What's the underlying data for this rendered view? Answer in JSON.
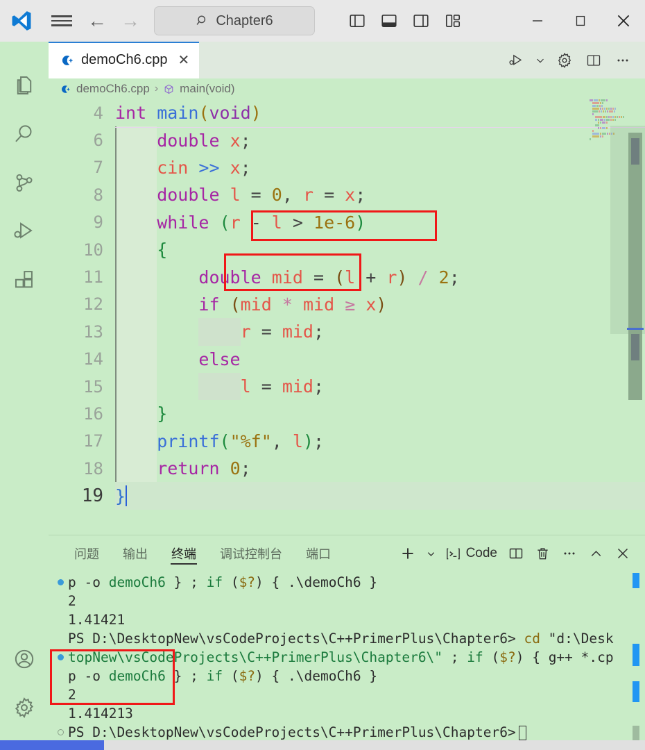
{
  "titlebar": {
    "logo_icon": "vscode-logo-icon",
    "menu_icon": "hamburger-menu-icon",
    "back_icon": "arrow-back-icon",
    "forward_icon": "arrow-forward-icon",
    "command_center": {
      "icon": "search-icon",
      "text": "Chapter6"
    },
    "layout_buttons": [
      {
        "name": "toggle-primary-sidebar",
        "icon": "panel-left-icon"
      },
      {
        "name": "toggle-panel",
        "icon": "panel-bottom-icon"
      },
      {
        "name": "toggle-secondary-sidebar",
        "icon": "panel-right-icon"
      },
      {
        "name": "customize-layout",
        "icon": "layout-grid-icon"
      }
    ],
    "window_controls": [
      {
        "name": "minimize-button",
        "glyph": "─"
      },
      {
        "name": "maximize-button",
        "glyph": "☐"
      },
      {
        "name": "close-button",
        "glyph": "✕"
      }
    ]
  },
  "activitybar": {
    "items": [
      {
        "name": "sidebar-item-explorer",
        "icon": "files-icon"
      },
      {
        "name": "sidebar-item-search",
        "icon": "search-icon"
      },
      {
        "name": "sidebar-item-source-control",
        "icon": "source-control-icon"
      },
      {
        "name": "sidebar-item-run-debug",
        "icon": "run-and-debug-icon"
      },
      {
        "name": "sidebar-item-extensions",
        "icon": "extensions-icon"
      }
    ],
    "bottom_items": [
      {
        "name": "sidebar-item-account",
        "icon": "account-icon"
      },
      {
        "name": "sidebar-item-settings",
        "icon": "gear-icon"
      }
    ]
  },
  "tabs": {
    "active": {
      "label": "demoCh6.cpp",
      "icon": "cpp-file-icon",
      "close_glyph": "✕"
    },
    "editor_actions": [
      {
        "name": "run-or-debug-button",
        "icon": "run-debug-icon"
      },
      {
        "name": "run-debug-dropdown",
        "icon": "chevron-down-icon"
      },
      {
        "name": "settings-gear-button",
        "icon": "gear-icon"
      },
      {
        "name": "split-editor-button",
        "icon": "split-editor-icon"
      },
      {
        "name": "more-actions-button",
        "icon": "ellipsis-icon"
      }
    ]
  },
  "breadcrumb": {
    "file_icon": "cpp-file-icon",
    "file": "demoCh6.cpp",
    "separator": "›",
    "symbol_icon": "symbol-method-icon",
    "symbol": "main(void)"
  },
  "editor": {
    "language": "cpp",
    "lines": [
      {
        "number": "4",
        "tokens": [
          {
            "t": "int",
            "c": "kw"
          },
          {
            "t": " ",
            "c": "punc"
          },
          {
            "t": "main",
            "c": "fn"
          },
          {
            "t": "(",
            "c": "pnt2"
          },
          {
            "t": "void",
            "c": "kw2"
          },
          {
            "t": ")",
            "c": "pnt2"
          }
        ]
      },
      {
        "number": "6",
        "tokens": [
          {
            "t": "double",
            "c": "kw"
          },
          {
            "t": " ",
            "c": "punc"
          },
          {
            "t": "x",
            "c": "var"
          },
          {
            "t": ";",
            "c": "punc"
          }
        ]
      },
      {
        "number": "7",
        "tokens": [
          {
            "t": "cin",
            "c": "var"
          },
          {
            "t": " ",
            "c": "punc"
          },
          {
            "t": ">>",
            "c": "fn"
          },
          {
            "t": " ",
            "c": "punc"
          },
          {
            "t": "x",
            "c": "var"
          },
          {
            "t": ";",
            "c": "punc"
          }
        ]
      },
      {
        "number": "8",
        "tokens": [
          {
            "t": "double",
            "c": "kw"
          },
          {
            "t": " ",
            "c": "punc"
          },
          {
            "t": "l",
            "c": "var"
          },
          {
            "t": " = ",
            "c": "punc"
          },
          {
            "t": "0",
            "c": "num"
          },
          {
            "t": ", ",
            "c": "punc"
          },
          {
            "t": "r",
            "c": "var"
          },
          {
            "t": " = ",
            "c": "punc"
          },
          {
            "t": "x",
            "c": "var"
          },
          {
            "t": ";",
            "c": "punc"
          }
        ]
      },
      {
        "number": "9",
        "tokens": [
          {
            "t": "while",
            "c": "kw"
          },
          {
            "t": " ",
            "c": "punc"
          },
          {
            "t": "(",
            "c": "pnt1"
          },
          {
            "t": "r",
            "c": "var"
          },
          {
            "t": " - ",
            "c": "punc"
          },
          {
            "t": "l",
            "c": "var"
          },
          {
            "t": " > ",
            "c": "punc"
          },
          {
            "t": "1e-6",
            "c": "num"
          },
          {
            "t": ")",
            "c": "pnt1"
          }
        ]
      },
      {
        "number": "10",
        "tokens": [
          {
            "t": "{",
            "c": "brace"
          }
        ]
      },
      {
        "number": "11",
        "tokens": [
          {
            "t": "double",
            "c": "kw"
          },
          {
            "t": " ",
            "c": "punc"
          },
          {
            "t": "mid",
            "c": "var"
          },
          {
            "t": " = ",
            "c": "punc"
          },
          {
            "t": "(",
            "c": "pnt3"
          },
          {
            "t": "l",
            "c": "var"
          },
          {
            "t": " + ",
            "c": "punc"
          },
          {
            "t": "r",
            "c": "var"
          },
          {
            "t": ")",
            "c": "pnt3"
          },
          {
            "t": " ",
            "c": "punc"
          },
          {
            "t": "/",
            "c": "op"
          },
          {
            "t": " ",
            "c": "punc"
          },
          {
            "t": "2",
            "c": "num"
          },
          {
            "t": ";",
            "c": "punc"
          }
        ]
      },
      {
        "number": "12",
        "tokens": [
          {
            "t": "if",
            "c": "kw"
          },
          {
            "t": " ",
            "c": "punc"
          },
          {
            "t": "(",
            "c": "pnt3"
          },
          {
            "t": "mid",
            "c": "var"
          },
          {
            "t": " ",
            "c": "punc"
          },
          {
            "t": "*",
            "c": "op"
          },
          {
            "t": " ",
            "c": "punc"
          },
          {
            "t": "mid",
            "c": "var"
          },
          {
            "t": " ",
            "c": "punc"
          },
          {
            "t": "≥",
            "c": "op"
          },
          {
            "t": " ",
            "c": "punc"
          },
          {
            "t": "x",
            "c": "var"
          },
          {
            "t": ")",
            "c": "pnt3"
          }
        ]
      },
      {
        "number": "13",
        "tokens": [
          {
            "t": "r",
            "c": "var"
          },
          {
            "t": " = ",
            "c": "punc"
          },
          {
            "t": "mid",
            "c": "var"
          },
          {
            "t": ";",
            "c": "punc"
          }
        ]
      },
      {
        "number": "14",
        "tokens": [
          {
            "t": "else",
            "c": "kw"
          }
        ]
      },
      {
        "number": "15",
        "tokens": [
          {
            "t": "l",
            "c": "var"
          },
          {
            "t": " = ",
            "c": "punc"
          },
          {
            "t": "mid",
            "c": "var"
          },
          {
            "t": ";",
            "c": "punc"
          }
        ]
      },
      {
        "number": "16",
        "tokens": [
          {
            "t": "}",
            "c": "brace"
          }
        ]
      },
      {
        "number": "17",
        "tokens": [
          {
            "t": "printf",
            "c": "fn"
          },
          {
            "t": "(",
            "c": "pnt1"
          },
          {
            "t": "\"%f\"",
            "c": "str"
          },
          {
            "t": ", ",
            "c": "punc"
          },
          {
            "t": "l",
            "c": "var"
          },
          {
            "t": ")",
            "c": "pnt1"
          },
          {
            "t": ";",
            "c": "punc"
          }
        ]
      },
      {
        "number": "18",
        "tokens": [
          {
            "t": "return",
            "c": "kw"
          },
          {
            "t": " ",
            "c": "punc"
          },
          {
            "t": "0",
            "c": "num"
          },
          {
            "t": ";",
            "c": "punc"
          }
        ]
      },
      {
        "number": "19",
        "tokens": [
          {
            "t": "}",
            "c": "brace2"
          }
        ]
      }
    ],
    "highlight_boxes": [
      {
        "name": "highlight-while-condition",
        "color": "#f01818"
      },
      {
        "name": "highlight-double-mid",
        "color": "#f01818"
      }
    ]
  },
  "panel": {
    "tabs": [
      {
        "name": "tab-problems",
        "label": "问题",
        "active": false
      },
      {
        "name": "tab-output",
        "label": "输出",
        "active": false
      },
      {
        "name": "tab-terminal",
        "label": "终端",
        "active": true
      },
      {
        "name": "tab-debug-console",
        "label": "调试控制台",
        "active": false
      },
      {
        "name": "tab-ports",
        "label": "端口",
        "active": false
      }
    ],
    "actions": {
      "new_terminal_icon": "plus-icon",
      "new_terminal_dropdown_icon": "chevron-down-icon",
      "shell_icon": "terminal-icon",
      "shell_label": "Code",
      "split_icon": "split-terminal-icon",
      "kill_icon": "trash-icon",
      "more_icon": "ellipsis-icon",
      "collapse_icon": "chevron-up-icon",
      "close_icon": "close-icon"
    },
    "terminal_lines": [
      {
        "marker": "blue",
        "segments": [
          {
            "t": "p -o ",
            "c": ""
          },
          {
            "t": "demoCh6",
            "c": "tgreen"
          },
          {
            "t": " } ; ",
            "c": ""
          },
          {
            "t": "if",
            "c": "tgreen"
          },
          {
            "t": " (",
            "c": ""
          },
          {
            "t": "$?",
            "c": "tgold"
          },
          {
            "t": ") { .\\demoCh6 }",
            "c": ""
          }
        ]
      },
      {
        "marker": "none",
        "segments": [
          {
            "t": "2",
            "c": ""
          }
        ]
      },
      {
        "marker": "none",
        "segments": [
          {
            "t": "1.41421",
            "c": ""
          }
        ]
      },
      {
        "marker": "none",
        "segments": [
          {
            "t": "PS D:\\DesktopNew\\vsCodeProjects\\C++PrimerPlus\\Chapter6> ",
            "c": ""
          },
          {
            "t": "cd",
            "c": "tgold"
          },
          {
            "t": " \"d:\\Desk",
            "c": ""
          }
        ]
      },
      {
        "marker": "blue",
        "segments": [
          {
            "t": "topNew\\vsCodeProjects\\C++PrimerPlus\\Chapter6\\\"",
            "c": "tgreen"
          },
          {
            "t": " ; ",
            "c": ""
          },
          {
            "t": "if",
            "c": "tgreen"
          },
          {
            "t": " (",
            "c": ""
          },
          {
            "t": "$?",
            "c": "tgold"
          },
          {
            "t": ") { g++ *.cp",
            "c": ""
          }
        ]
      },
      {
        "marker": "none",
        "segments": [
          {
            "t": "p -o ",
            "c": ""
          },
          {
            "t": "demoCh6",
            "c": "tgreen"
          },
          {
            "t": " } ; ",
            "c": ""
          },
          {
            "t": "if",
            "c": "tgreen"
          },
          {
            "t": " (",
            "c": ""
          },
          {
            "t": "$?",
            "c": "tgold"
          },
          {
            "t": ") { .\\demoCh6 }",
            "c": ""
          }
        ]
      },
      {
        "marker": "none",
        "segments": [
          {
            "t": "2",
            "c": ""
          }
        ]
      },
      {
        "marker": "none",
        "segments": [
          {
            "t": "1.414213",
            "c": ""
          }
        ]
      },
      {
        "marker": "hollow",
        "segments": [
          {
            "t": "PS D:\\DesktopNew\\vsCodeProjects\\C++PrimerPlus\\Chapter6>",
            "c": ""
          }
        ],
        "cursor": true
      }
    ],
    "highlight_box": {
      "name": "highlight-terminal-output",
      "color": "#f01818"
    }
  },
  "statusbar": {
    "accent_color": "#4a6ae0"
  }
}
